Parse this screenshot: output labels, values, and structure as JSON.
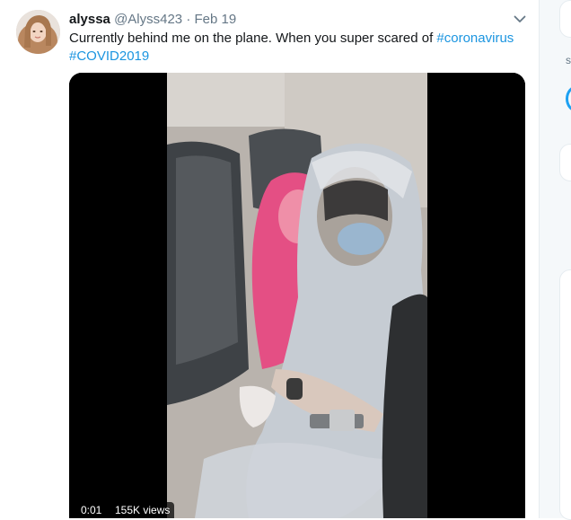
{
  "tweet": {
    "display_name": "alyssa",
    "handle": "@Alyss423",
    "separator": "·",
    "date": "Feb 19",
    "text_plain": "Currently behind me on the plane. When you super scared of ",
    "hashtag_1": "#coronavirus",
    "hashtag_2": "#COVID2019",
    "accent_color": "#1b95e0"
  },
  "video": {
    "time": "0:01",
    "views": "155K views"
  },
  "sidebar": {
    "partial_text": "s"
  },
  "icons": {
    "more": "chevron-down-icon"
  }
}
